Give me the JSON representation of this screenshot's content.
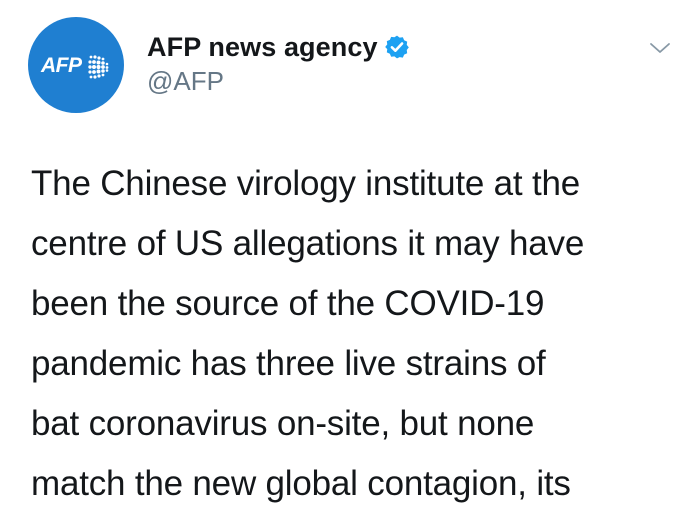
{
  "author": {
    "display_name": "AFP news agency",
    "handle": "@AFP",
    "verified": true,
    "avatar_logo_text": "AFP",
    "avatar_color": "#1f7fd1"
  },
  "icons": {
    "verified": "verified-badge-icon",
    "menu": "chevron-down-icon"
  },
  "tweet": {
    "lines": [
      "The Chinese virology institute at the",
      "centre of US allegations it may have",
      "been the source of the COVID-19",
      "pandemic has three live strains of",
      "bat coronavirus on-site, but none",
      "match the new global contagion, its"
    ]
  },
  "colors": {
    "text": "#14171a",
    "secondary_text": "#657786",
    "verified_blue": "#1da1f2"
  }
}
